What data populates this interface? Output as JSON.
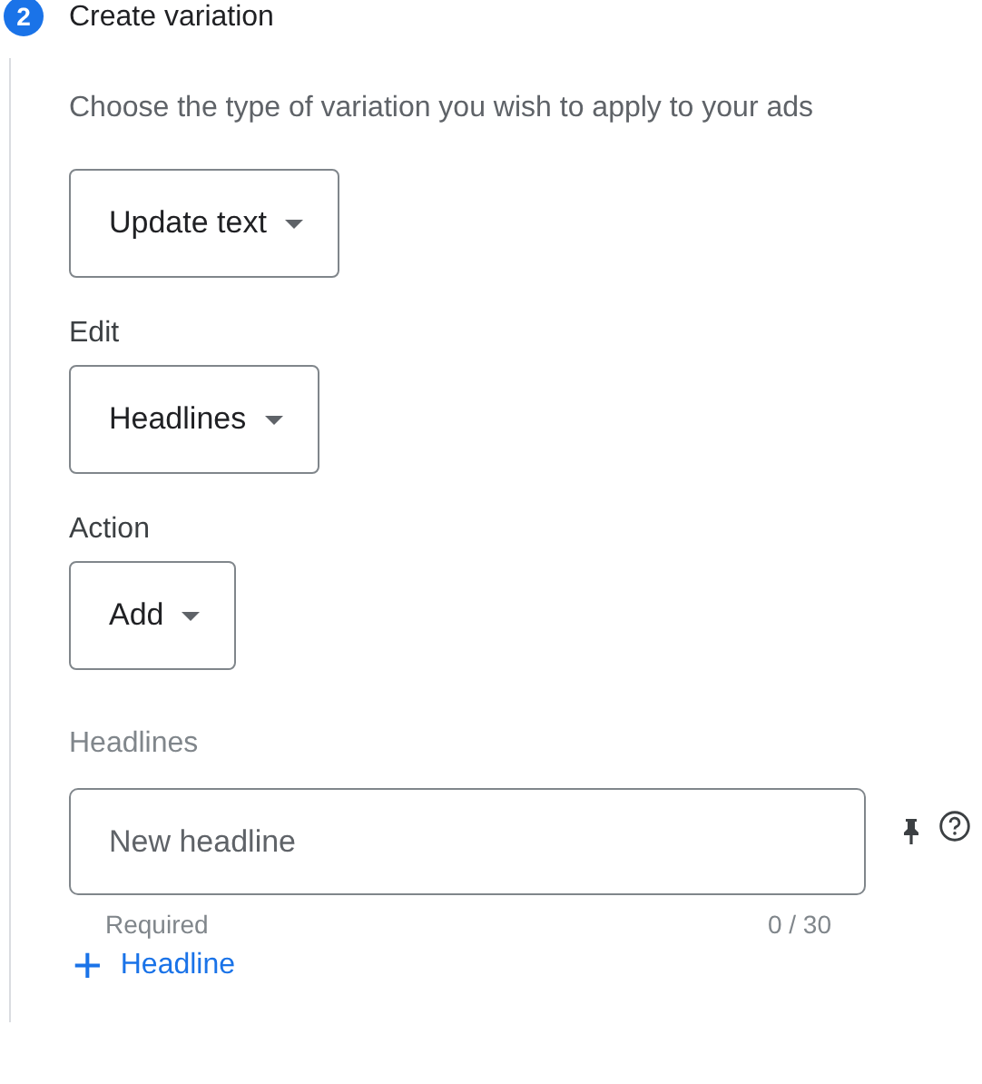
{
  "step": {
    "number": "2",
    "title": "Create variation"
  },
  "description": "Choose the type of variation you wish to apply to your ads",
  "dropdowns": [
    {
      "value": "Update text"
    },
    {
      "label": "Edit",
      "value": "Headlines"
    },
    {
      "label": "Action",
      "value": "Add"
    }
  ],
  "headlines": {
    "label": "Headlines",
    "placeholder": "New headline",
    "hint": "Required",
    "counter": "0 / 30"
  },
  "add_button": {
    "icon": "+",
    "label": "Headline"
  }
}
